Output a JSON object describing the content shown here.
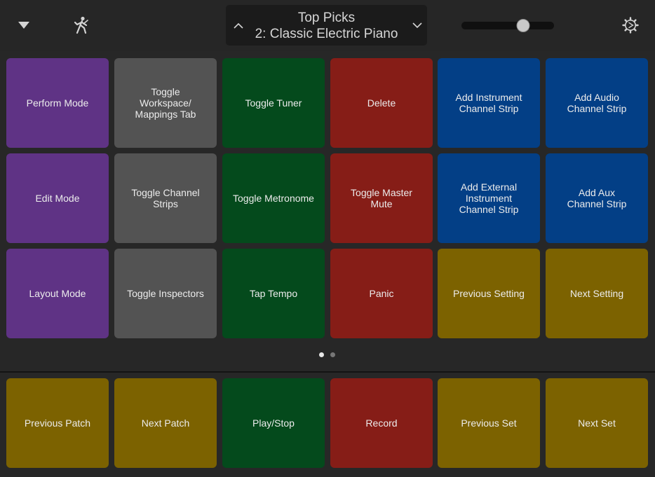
{
  "topbar": {
    "patch_category": "Top Picks",
    "patch_name": "2: Classic Electric Piano",
    "volume_level": 0.67,
    "icons": [
      "triangle-down-icon",
      "performer-icon",
      "chevron-up-icon",
      "chevron-down-icon",
      "gear-icon"
    ]
  },
  "colors": {
    "purple": "#5f3385",
    "gray": "#535353",
    "green": "#044a1c",
    "red": "#861d17",
    "blue": "#033f86",
    "gold": "#7c6200"
  },
  "grid": [
    [
      {
        "label": "Perform Mode",
        "color": "purple"
      },
      {
        "label": "Toggle\nWorkspace/\nMappings Tab",
        "color": "gray"
      },
      {
        "label": "Toggle Tuner",
        "color": "green"
      },
      {
        "label": "Delete",
        "color": "red"
      },
      {
        "label": "Add Instrument\nChannel Strip",
        "color": "blue"
      },
      {
        "label": "Add Audio\nChannel Strip",
        "color": "blue"
      }
    ],
    [
      {
        "label": "Edit Mode",
        "color": "purple"
      },
      {
        "label": "Toggle Channel\nStrips",
        "color": "gray"
      },
      {
        "label": "Toggle Metronome",
        "color": "green"
      },
      {
        "label": "Toggle Master\nMute",
        "color": "red"
      },
      {
        "label": "Add External\nInstrument\nChannel Strip",
        "color": "blue"
      },
      {
        "label": "Add Aux\nChannel Strip",
        "color": "blue"
      }
    ],
    [
      {
        "label": "Layout Mode",
        "color": "purple"
      },
      {
        "label": "Toggle Inspectors",
        "color": "gray"
      },
      {
        "label": "Tap Tempo",
        "color": "green"
      },
      {
        "label": "Panic",
        "color": "red"
      },
      {
        "label": "Previous Setting",
        "color": "gold"
      },
      {
        "label": "Next Setting",
        "color": "gold"
      }
    ]
  ],
  "page_indicator": {
    "pages": 2,
    "current": 1
  },
  "bottom_row": [
    {
      "label": "Previous Patch",
      "color": "gold"
    },
    {
      "label": "Next Patch",
      "color": "gold"
    },
    {
      "label": "Play/Stop",
      "color": "green"
    },
    {
      "label": "Record",
      "color": "red"
    },
    {
      "label": "Previous Set",
      "color": "gold"
    },
    {
      "label": "Next Set",
      "color": "gold"
    }
  ]
}
